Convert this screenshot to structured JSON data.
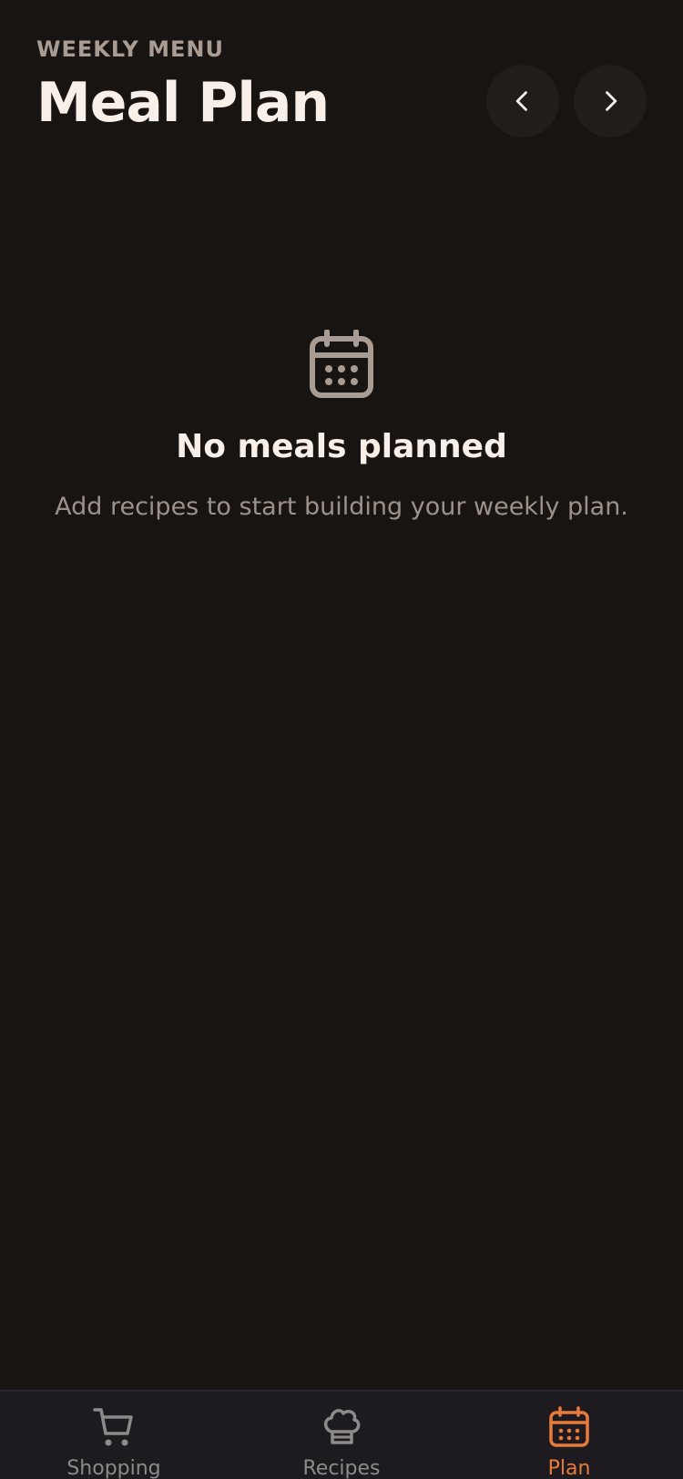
{
  "header": {
    "eyebrow": "WEEKLY MENU",
    "title": "Meal Plan",
    "prev_icon": "chevron-left-icon",
    "next_icon": "chevron-right-icon"
  },
  "empty_state": {
    "icon": "calendar-icon",
    "title": "No meals planned",
    "subtitle": "Add recipes to start building your weekly plan."
  },
  "tabbar": {
    "tabs": [
      {
        "label": "Shopping",
        "icon": "cart-icon",
        "active": false
      },
      {
        "label": "Recipes",
        "icon": "chef-hat-icon",
        "active": false
      },
      {
        "label": "Plan",
        "icon": "calendar-icon",
        "active": true
      }
    ]
  },
  "colors": {
    "background": "#181412",
    "accent": "#e97b3a",
    "muted": "#9d918a",
    "text": "#f7efe8"
  }
}
